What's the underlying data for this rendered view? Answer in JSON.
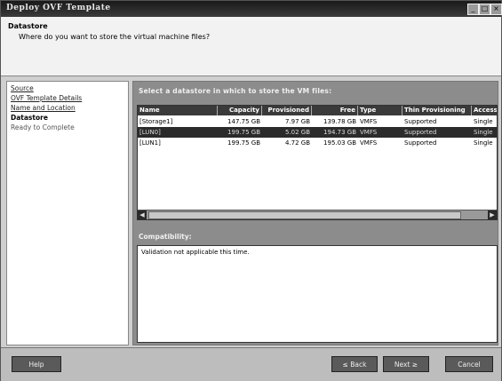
{
  "window": {
    "title": "Deploy OVF Template",
    "controls": [
      "_",
      "□",
      "×"
    ]
  },
  "header": {
    "title": "Datastore",
    "subtitle": "Where do you want to store the virtual machine files?"
  },
  "steps": [
    {
      "label": "Source",
      "state": "done"
    },
    {
      "label": "OVF Template Details",
      "state": "done"
    },
    {
      "label": "Name and Location",
      "state": "done"
    },
    {
      "label": "Datastore",
      "state": "current"
    },
    {
      "label": "Ready to Complete",
      "state": "future"
    }
  ],
  "datastores": {
    "label": "Select a datastore in which to store the VM files:",
    "columns": [
      "Name",
      "Capacity",
      "Provisioned",
      "Free",
      "Type",
      "Thin Provisioning",
      "Access"
    ],
    "rows": [
      {
        "name": "[Storage1]",
        "capacity": "147.75 GB",
        "provisioned": "7.97 GB",
        "free": "139.78 GB",
        "type": "VMFS",
        "thin": "Supported",
        "access": "Single"
      },
      {
        "name": "[LUN0]",
        "capacity": "199.75 GB",
        "provisioned": "5.02 GB",
        "free": "194.73 GB",
        "type": "VMFS",
        "thin": "Supported",
        "access": "Single"
      },
      {
        "name": "[LUN1]",
        "capacity": "199.75 GB",
        "provisioned": "4.72 GB",
        "free": "195.03 GB",
        "type": "VMFS",
        "thin": "Supported",
        "access": "Single"
      }
    ],
    "selected_row": 1
  },
  "compatibility": {
    "label": "Compatibility:",
    "text": "Validation not applicable this time."
  },
  "buttons": {
    "help": "Help",
    "back": "≤ Back",
    "next": "Next ≥",
    "cancel": "Cancel"
  }
}
